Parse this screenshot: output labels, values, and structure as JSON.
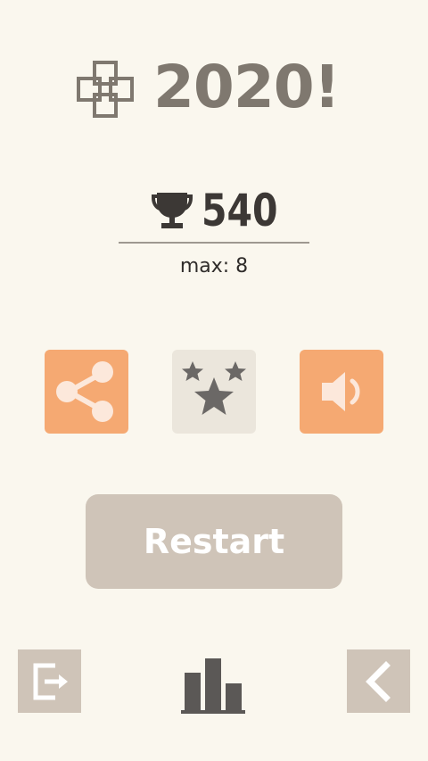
{
  "header": {
    "title": "2020!",
    "logo_icon": "grid-cluster-logo-icon"
  },
  "score": {
    "icon": "trophy-icon",
    "value": "540",
    "max_line": "max: 8"
  },
  "actions": {
    "share_icon": "share-icon",
    "rate_icon": "stars-icon",
    "sound_icon": "speaker-icon"
  },
  "restart": {
    "label": "Restart"
  },
  "bottom_bar": {
    "exit_icon": "exit-icon",
    "stats_icon": "bar-chart-icon",
    "back_icon": "chevron-left-icon"
  },
  "colors": {
    "background": "#faf7ee",
    "accent_orange": "#f5a972",
    "button_tan": "#cfc4b8",
    "title_gray": "#7f786f",
    "score_dark": "#3c3835"
  }
}
